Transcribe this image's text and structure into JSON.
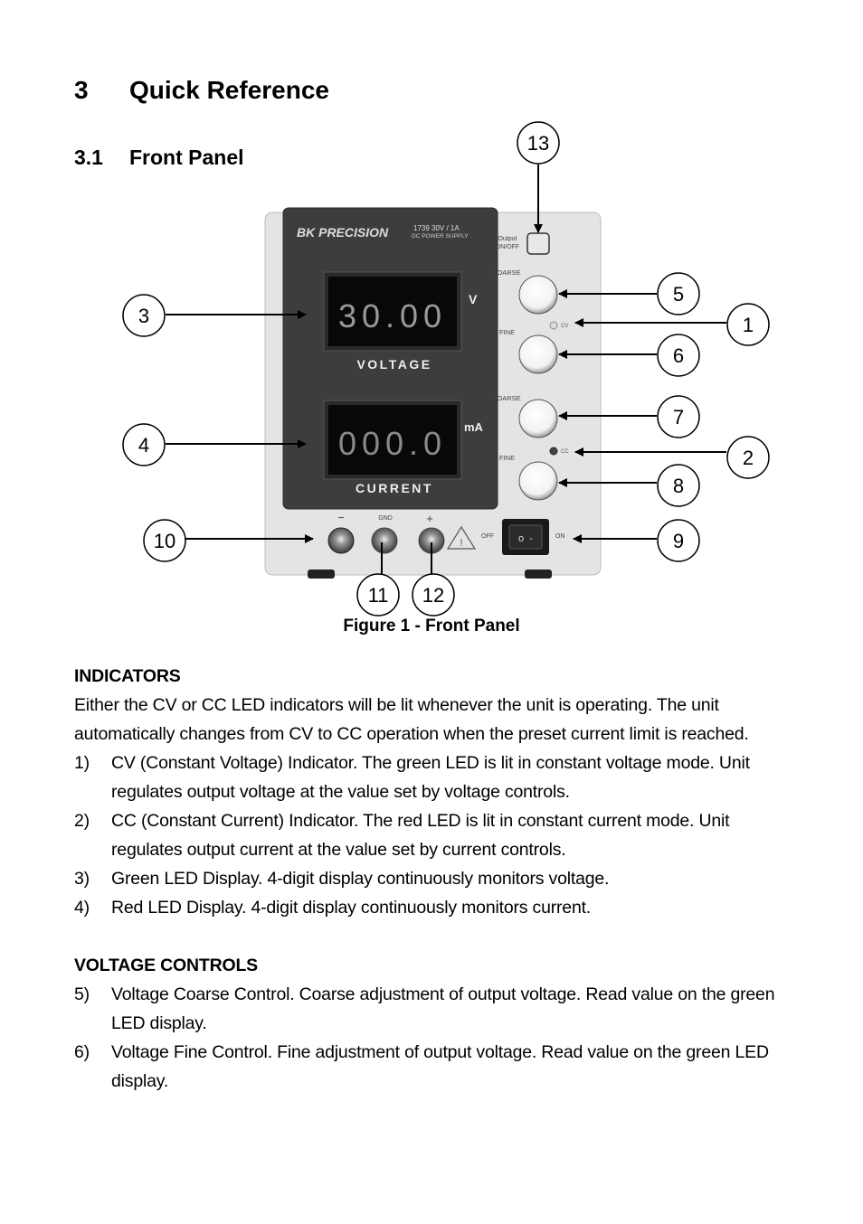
{
  "heading": {
    "number": "3",
    "title": "Quick Reference"
  },
  "subheading": {
    "number": "3.1",
    "title": "Front Panel"
  },
  "figure": {
    "caption": "Figure 1 - Front Panel",
    "device": {
      "brand": "BK PRECISION",
      "model": "1739  30V / 1A",
      "model_sub": "DC POWER SUPPLY",
      "output_button_label_1": "Output",
      "output_button_label_2": "ON/OFF",
      "voltage_display": "30.00",
      "voltage_unit": "V",
      "voltage_label": "VOLTAGE",
      "current_display": "000.0",
      "current_unit": "mA",
      "current_label": "CURRENT",
      "coarse_label": "COARSE",
      "fine_label": "FINE",
      "cv_label": "CV",
      "cc_label": "CC",
      "terminal_minus": "−",
      "terminal_gnd": "GND",
      "terminal_plus": "+",
      "switch_off": "OFF",
      "switch_on": "ON",
      "switch_glyph": "o  -"
    },
    "callouts": [
      "1",
      "2",
      "3",
      "4",
      "5",
      "6",
      "7",
      "8",
      "9",
      "10",
      "11",
      "12",
      "13"
    ]
  },
  "indicators": {
    "title": "INDICATORS",
    "intro": "Either the CV or CC LED indicators will be lit whenever the unit is operating. The unit automatically changes from CV to CC operation when the preset current limit is reached.",
    "items": [
      {
        "n": "1)",
        "text": "CV (Constant Voltage) Indicator. The green LED is lit in constant voltage mode. Unit regulates output voltage at the value set by voltage controls."
      },
      {
        "n": "2)",
        "text": "CC (Constant Current) Indicator. The red LED is lit in constant current mode. Unit regulates output current at the value set by current controls."
      },
      {
        "n": "3)",
        "text": "Green LED Display. 4-digit display continuously monitors voltage."
      },
      {
        "n": "4)",
        "text": "Red LED Display. 4-digit display continuously monitors current."
      }
    ]
  },
  "voltage_controls": {
    "title": "VOLTAGE CONTROLS",
    "items": [
      {
        "n": "5)",
        "text": "Voltage Coarse Control. Coarse adjustment of output voltage. Read value on the green LED display."
      },
      {
        "n": "6)",
        "text": "Voltage Fine Control. Fine adjustment of output voltage. Read value on the green LED display."
      }
    ]
  }
}
